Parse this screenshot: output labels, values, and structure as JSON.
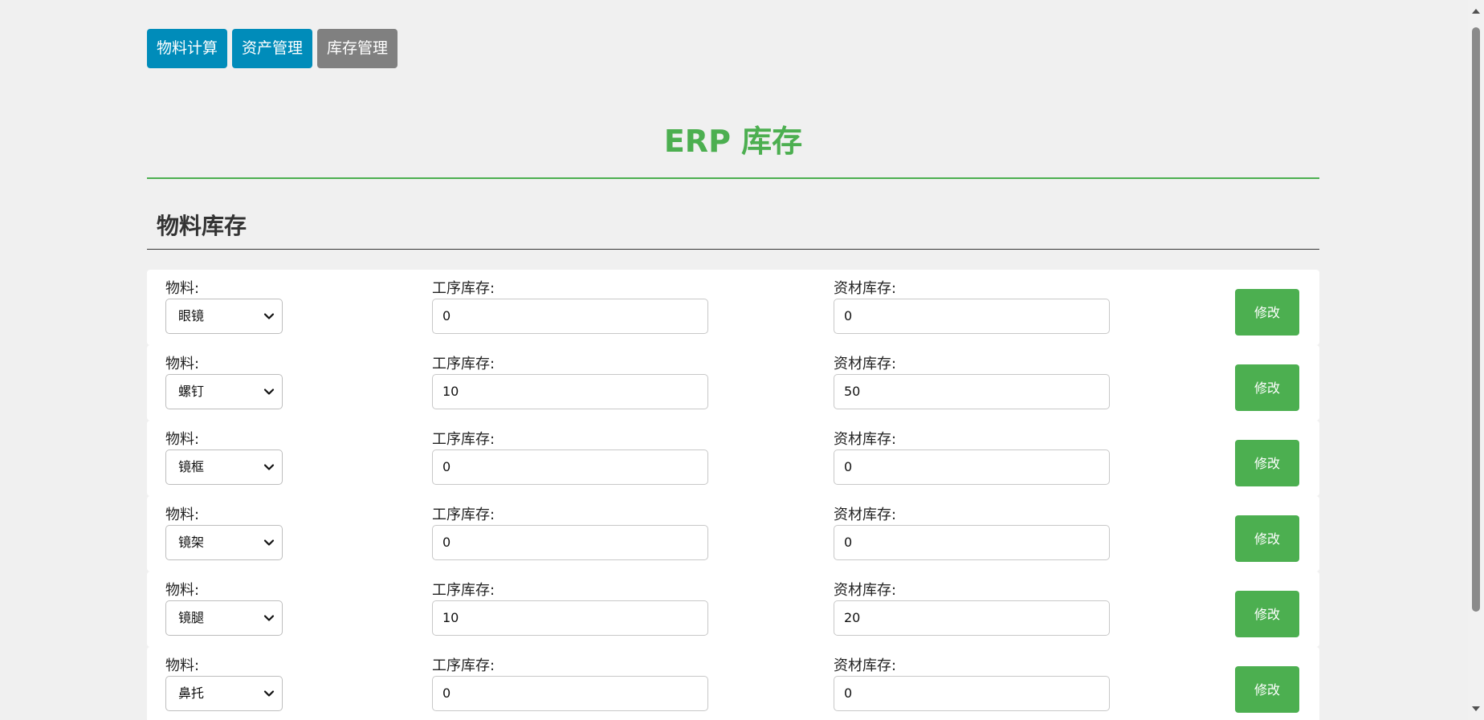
{
  "nav": {
    "buttons": [
      {
        "label": "物料计算",
        "state": "primary"
      },
      {
        "label": "资产管理",
        "state": "primary"
      },
      {
        "label": "库存管理",
        "state": "active"
      }
    ]
  },
  "page": {
    "title": "ERP 库存",
    "section_title": "物料库存"
  },
  "colors": {
    "accent_green": "#4caf50",
    "nav_blue": "#008cba",
    "nav_active_gray": "#808080"
  },
  "labels": {
    "material": "物料:",
    "process_stock": "工序库存:",
    "material_stock": "资材库存:",
    "edit": "修改"
  },
  "rows": [
    {
      "material": "眼镜",
      "process_stock": "0",
      "material_stock": "0"
    },
    {
      "material": "螺钉",
      "process_stock": "10",
      "material_stock": "50"
    },
    {
      "material": "镜框",
      "process_stock": "0",
      "material_stock": "0"
    },
    {
      "material": "镜架",
      "process_stock": "0",
      "material_stock": "0"
    },
    {
      "material": "镜腿",
      "process_stock": "10",
      "material_stock": "20"
    },
    {
      "material": "鼻托",
      "process_stock": "0",
      "material_stock": "0"
    }
  ]
}
